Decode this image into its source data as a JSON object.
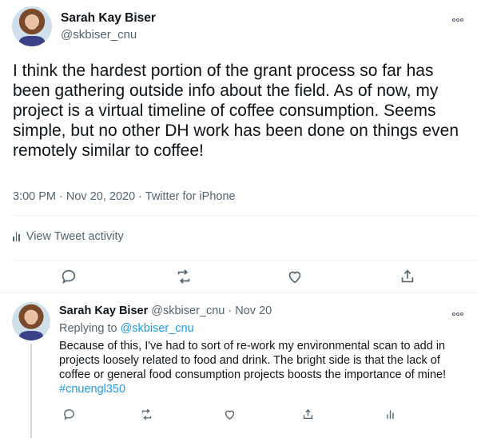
{
  "main_tweet": {
    "author_name": "Sarah Kay Biser",
    "author_handle": "@skbiser_cnu",
    "text": "I think the hardest portion of the grant process so far has been gathering outside info about the field. As of now, my project is a virtual timeline of coffee consumption. Seems simple, but no other DH work has been done on things even remotely similar to coffee!",
    "meta": "3:00 PM · Nov 20, 2020 · Twitter for iPhone",
    "activity_label": "View Tweet activity",
    "icons": [
      "reply-icon",
      "retweet-icon",
      "like-icon",
      "share-icon"
    ]
  },
  "reply_tweet": {
    "author_name": "Sarah Kay Biser",
    "author_handle": "@skbiser_cnu",
    "separator": "·",
    "date": "Nov 20",
    "replying_prefix": "Replying to ",
    "replying_to": "@skbiser_cnu",
    "text": "Because of this, I've had to sort of re-work my environmental scan to add in projects loosely related to food and drink. The bright side is that the lack of coffee or general food consumption projects boosts the importance of mine! ",
    "hashtag": "#cnuengl350",
    "icons": [
      "reply-icon",
      "retweet-icon",
      "like-icon",
      "share-icon",
      "analytics-icon"
    ]
  },
  "colors": {
    "accent": "#1d9bf0",
    "secondary_text": "#536471",
    "primary_text": "#0f1419"
  }
}
